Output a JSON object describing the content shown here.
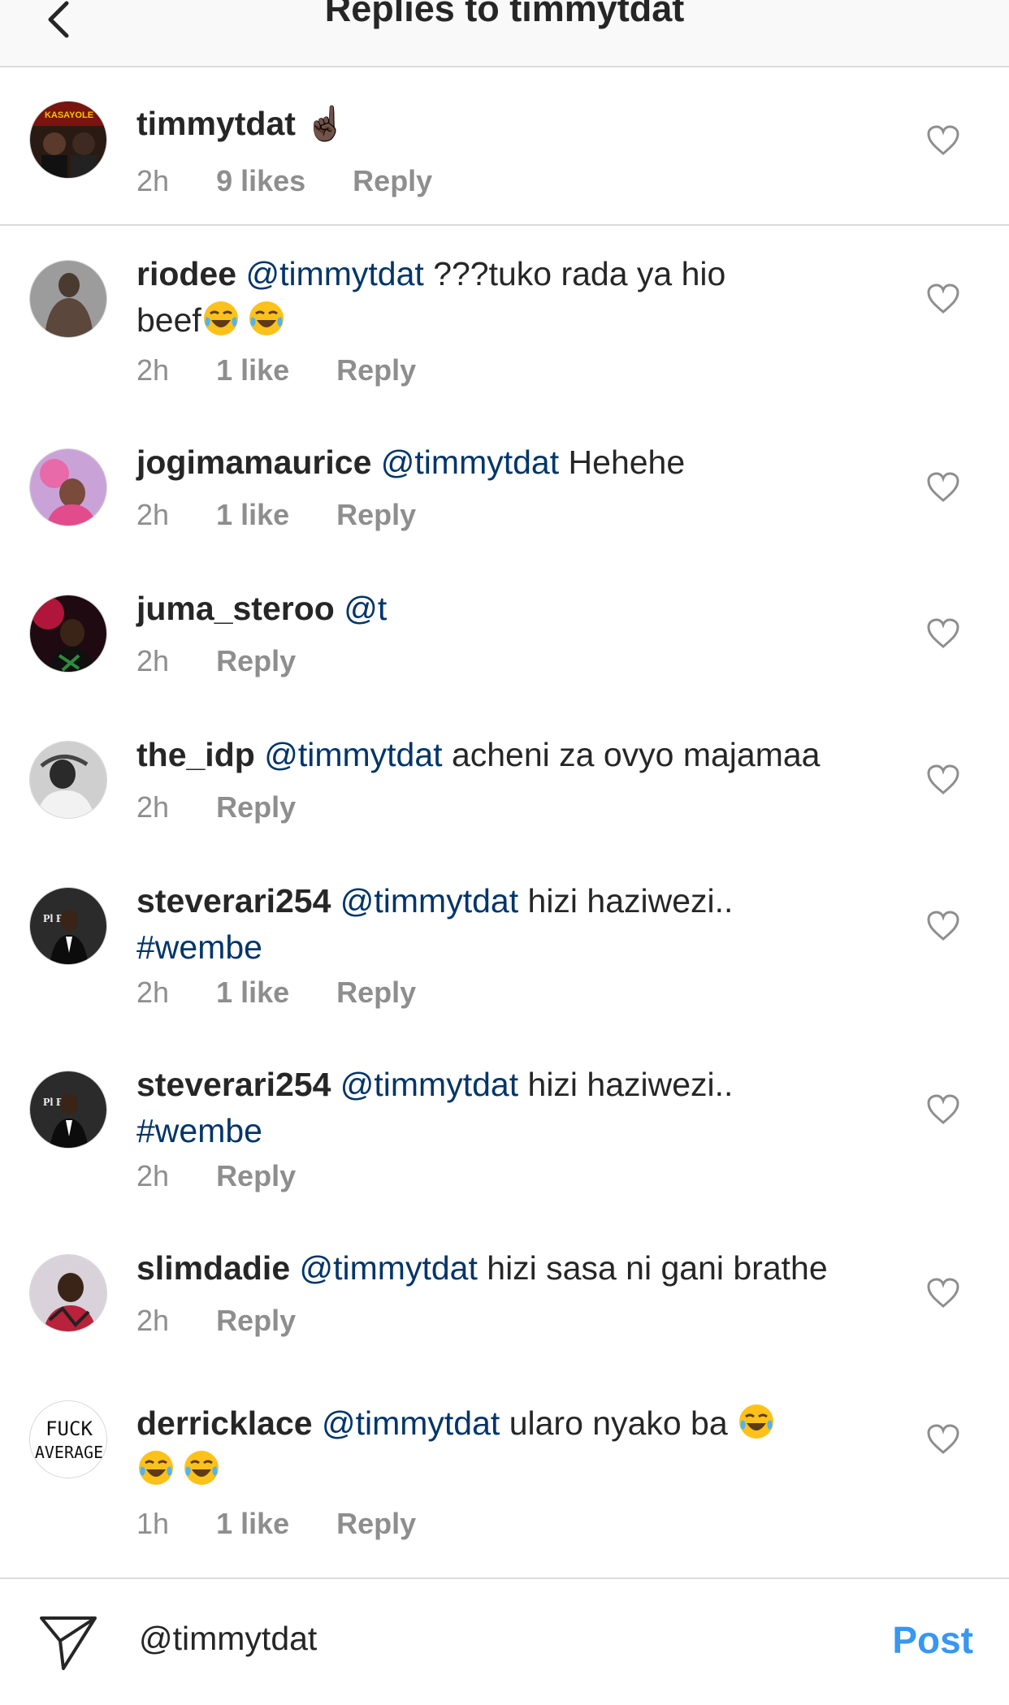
{
  "header": {
    "title": "Replies to timmytdat",
    "back_icon": "chevron-left-icon"
  },
  "parent": {
    "user": "timmytdat",
    "emoji": "☝🏿",
    "time": "2h",
    "likes": "9 likes",
    "reply": "Reply"
  },
  "replies": [
    {
      "user": "riodee",
      "mention": "@timmytdat",
      "text": "???tuko rada ya hio",
      "text2": "beef",
      "time": "2h",
      "likes": "1 like",
      "reply": "Reply"
    },
    {
      "user": "jogimamaurice",
      "mention": "@timmytdat",
      "text": "Hehehe",
      "time": "2h",
      "likes": "1 like",
      "reply": "Reply"
    },
    {
      "user": "juma_steroo",
      "mention": "@t",
      "text": "",
      "time": "2h",
      "reply": "Reply"
    },
    {
      "user": "the_idp",
      "mention": "@timmytdat",
      "text": "acheni za ovyo majamaa",
      "time": "2h",
      "reply": "Reply"
    },
    {
      "user": "steverari254",
      "mention": "@timmytdat",
      "text": "hizi haziwezi..",
      "hashtag": "#wembe",
      "time": "2h",
      "likes": "1 like",
      "reply": "Reply"
    },
    {
      "user": "steverari254",
      "mention": "@timmytdat",
      "text": "hizi haziwezi..",
      "hashtag": "#wembe",
      "time": "2h",
      "reply": "Reply"
    },
    {
      "user": "slimdadie",
      "mention": "@timmytdat",
      "text": "hizi sasa ni gani brathe",
      "time": "2h",
      "reply": "Reply"
    },
    {
      "user": "derricklace",
      "mention": "@timmytdat",
      "text": "ularo nyako ba",
      "time": "1h",
      "likes": "1 like",
      "reply": "Reply"
    }
  ],
  "avatars": {
    "parent_badge": "KASAYOLE",
    "steverari_badge": "Pl Bo",
    "derricklace_line1": "FUCK",
    "derricklace_line2": "AVERAGE"
  },
  "composer": {
    "value": "@timmytdat",
    "post_label": "Post",
    "send_icon": "paper-plane-icon"
  },
  "colors": {
    "mention": "#003569",
    "meta": "#8e8e8e",
    "post": "#3897f0",
    "divider": "#dbdbdb"
  }
}
